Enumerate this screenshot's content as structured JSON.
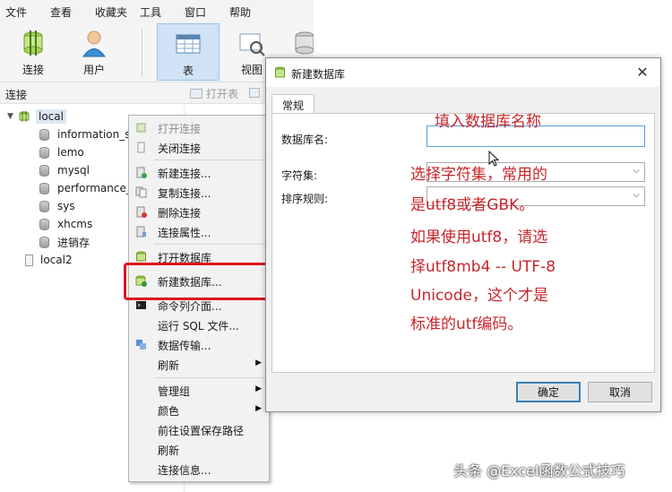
{
  "menubar": {
    "items": [
      "文件",
      "查看",
      "收藏夹",
      "工具",
      "窗口",
      "帮助"
    ]
  },
  "toolbar": {
    "connect": "连接",
    "user": "用户",
    "table": "表",
    "view": "视图"
  },
  "connections_panel": {
    "title": "连接",
    "open_table": "打开表"
  },
  "tree": {
    "connection": "local",
    "databases": [
      "information_s",
      "lemo",
      "mysql",
      "performance_",
      "sys",
      "xhcms",
      "进销存"
    ],
    "connection2": "local2"
  },
  "context_menu": {
    "items": [
      "打开连接",
      "关闭连接",
      "新建连接...",
      "复制连接...",
      "删除连接",
      "连接属性...",
      "打开数据库",
      "新建数据库...",
      "命令列介面...",
      "运行 SQL 文件...",
      "数据传输...",
      "刷新",
      "管理组",
      "颜色",
      "前往设置保存路径",
      "刷新",
      "连接信息..."
    ]
  },
  "dialog": {
    "title": "新建数据库",
    "tab": "常规",
    "db_name_label": "数据库名:",
    "db_name_value": "",
    "charset_label": "字符集:",
    "collation_label": "排序规则:",
    "ok": "确定",
    "cancel": "取消"
  },
  "annotations": {
    "fill_name": "填入数据库名称",
    "line1": "选择字符集，常用的",
    "line2": "是utf8或者GBK。",
    "line3": "如果使用utf8，请选",
    "line4": "择utf8mb4 -- UTF-8",
    "line5": "Unicode，这个才是",
    "line6": "标准的utf编码。"
  },
  "watermark": "头条 @Excel函数公式技巧",
  "colors": {
    "annotation": "#c7252b",
    "highlight": "#e0141e",
    "selection": "#cfe3f5"
  }
}
